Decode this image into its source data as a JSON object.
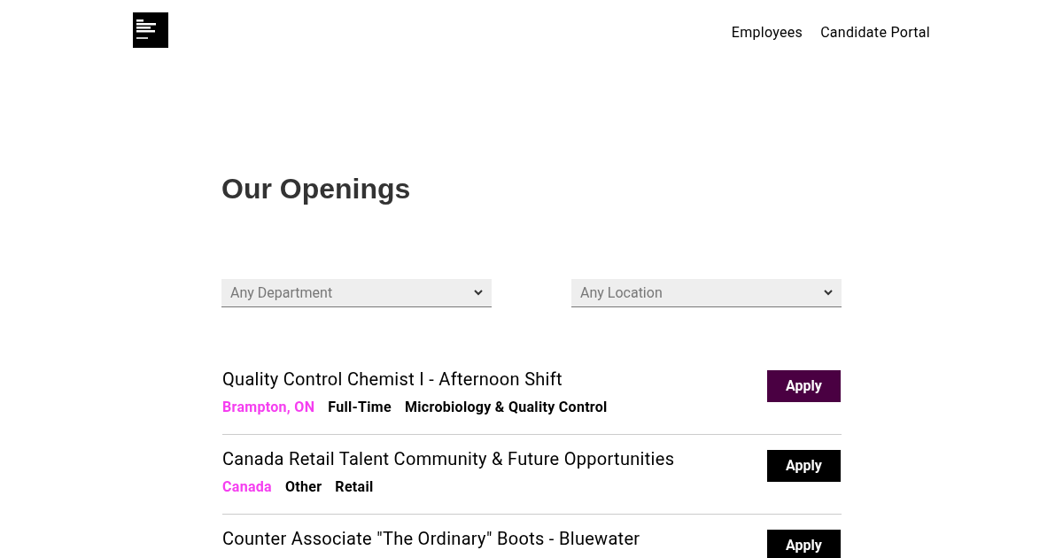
{
  "header": {
    "nav": [
      "Employees",
      "Candidate Portal"
    ]
  },
  "title": "Our Openings",
  "filters": [
    {
      "placeholder": "Any Department"
    },
    {
      "placeholder": "Any Location"
    }
  ],
  "jobs": [
    {
      "title": "Quality Control Chemist I - Afternoon Shift",
      "location": "Brampton, ON",
      "tags": [
        "Full-Time",
        "Microbiology & Quality Control"
      ],
      "button": "Apply",
      "highlighted": true
    },
    {
      "title": "Canada Retail Talent Community & Future Opportunities",
      "location": "Canada",
      "tags": [
        "Other",
        "Retail"
      ],
      "button": "Apply",
      "highlighted": false
    },
    {
      "title": "Counter Associate \"The Ordinary\" Boots - Bluewater",
      "button": "Apply",
      "highlighted": false
    }
  ]
}
